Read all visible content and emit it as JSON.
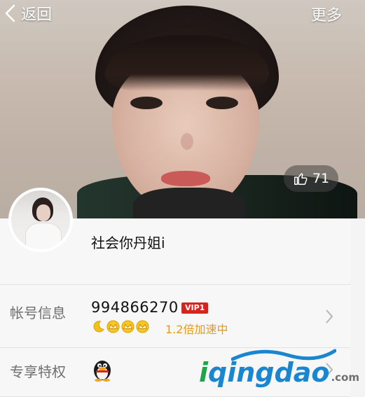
{
  "header": {
    "back_label": "返回",
    "more_label": "更多"
  },
  "cover": {
    "like_count": "71"
  },
  "profile": {
    "nickname": "社会你丹姐i"
  },
  "account": {
    "label": "帐号信息",
    "number": "994866270",
    "vip_badge": "VIP1",
    "speed_text": "1.2倍加速中",
    "level_icons": [
      "moon-icon",
      "crown-icon",
      "crown-icon",
      "crown-icon"
    ]
  },
  "privilege": {
    "label": "专享特权"
  },
  "watermark": {
    "text_i": "i",
    "text_main": "qingdao",
    "text_domain": ".com"
  },
  "colors": {
    "vip": "#d6241c",
    "speed": "#e79a10",
    "brand_green": "#1fa44a",
    "brand_blue": "#1a86d0"
  }
}
